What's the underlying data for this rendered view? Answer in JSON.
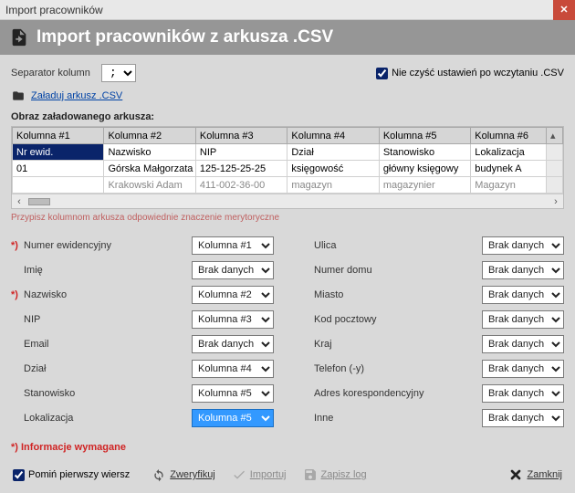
{
  "window": {
    "title": "Import pracowników"
  },
  "header": {
    "title": "Import pracowników z arkusza .CSV"
  },
  "separator": {
    "label": "Separator kolumn",
    "value": ";"
  },
  "no_clear": {
    "checked": true,
    "label": "Nie czyść ustawień po wczytaniu .CSV"
  },
  "load_link": "Załaduj arkusz .CSV",
  "preview_label": "Obraz załadowanego arkusza:",
  "columns": [
    "Kolumna #1",
    "Kolumna #2",
    "Kolumna #3",
    "Kolumna #4",
    "Kolumna #5",
    "Kolumna #6"
  ],
  "rows": [
    [
      "Nr ewid.",
      "Nazwisko",
      "NIP",
      "Dział",
      "Stanowisko",
      "Lokalizacja"
    ],
    [
      "01",
      "Górska Małgorzata",
      "125-125-25-25",
      "księgowość",
      "główny księgowy",
      "budynek A"
    ],
    [
      "",
      "Krakowski Adam",
      "411-002-36-00",
      "magazyn",
      "magazynier",
      "Magazyn"
    ]
  ],
  "hint": "Przypisz kolumnom arkusza odpowiednie znaczenie merytoryczne",
  "no_data": "Brak danych",
  "left_fields": [
    {
      "req": true,
      "label": "Numer ewidencyjny",
      "value": "Kolumna #1"
    },
    {
      "req": false,
      "label": "Imię",
      "value": "Brak danych"
    },
    {
      "req": true,
      "label": "Nazwisko",
      "value": "Kolumna #2"
    },
    {
      "req": false,
      "label": "NIP",
      "value": "Kolumna #3"
    },
    {
      "req": false,
      "label": "Email",
      "value": "Brak danych"
    },
    {
      "req": false,
      "label": "Dział",
      "value": "Kolumna #4"
    },
    {
      "req": false,
      "label": "Stanowisko",
      "value": "Kolumna #5"
    },
    {
      "req": false,
      "label": "Lokalizacja",
      "value": "Kolumna #5",
      "highlight": true
    }
  ],
  "right_fields": [
    {
      "label": "Ulica",
      "value": "Brak danych"
    },
    {
      "label": "Numer domu",
      "value": "Brak danych"
    },
    {
      "label": "Miasto",
      "value": "Brak danych"
    },
    {
      "label": "Kod pocztowy",
      "value": "Brak danych"
    },
    {
      "label": "Kraj",
      "value": "Brak danych"
    },
    {
      "label": "Telefon (-y)",
      "value": "Brak danych"
    },
    {
      "label": "Adres korespondencyjny",
      "value": "Brak danych"
    },
    {
      "label": "Inne",
      "value": "Brak danych"
    }
  ],
  "req_note": "*) Informacje wymagane",
  "footer": {
    "skip_first": {
      "checked": true,
      "label": "Pomiń pierwszy wiersz"
    },
    "verify": "Zweryfikuj",
    "import": "Importuj",
    "savelog": "Zapisz log",
    "close": "Zamknij"
  }
}
